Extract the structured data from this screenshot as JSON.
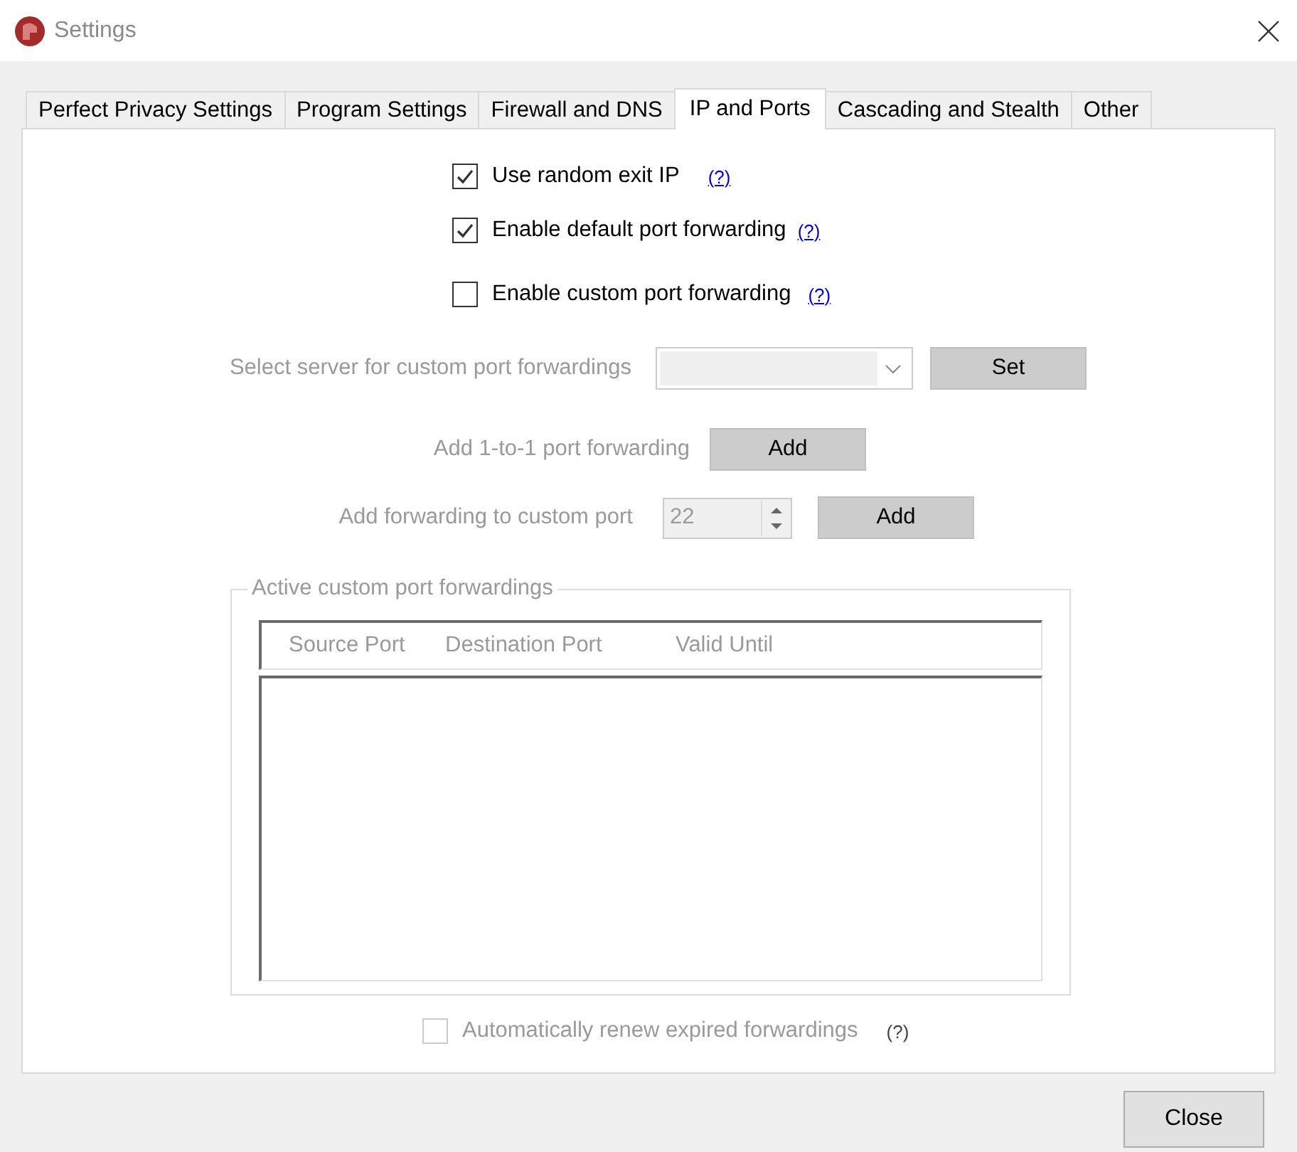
{
  "window": {
    "title": "Settings"
  },
  "tabs": [
    {
      "label": "Perfect Privacy Settings",
      "selected": false
    },
    {
      "label": "Program Settings",
      "selected": false
    },
    {
      "label": "Firewall and DNS",
      "selected": false
    },
    {
      "label": "IP and Ports",
      "selected": true
    },
    {
      "label": "Cascading and Stealth",
      "selected": false
    },
    {
      "label": "Other",
      "selected": false
    }
  ],
  "options": [
    {
      "label": "Use random exit IP",
      "checked": true,
      "disabled": false,
      "help": "(?)"
    },
    {
      "label": "Enable default port forwarding",
      "checked": true,
      "disabled": false,
      "help": "(?)"
    },
    {
      "label": "Enable custom port forwarding",
      "checked": false,
      "disabled": false,
      "help": "(?)"
    }
  ],
  "server_select": {
    "label": "Select server for custom port forwardings",
    "disabled": true,
    "button": "Set"
  },
  "one_to_one": {
    "label": "Add 1-to-1 port forwarding",
    "disabled": true,
    "button": "Add"
  },
  "custom_port": {
    "label": "Add forwarding to custom port",
    "disabled": true,
    "value": "22",
    "button": "Add"
  },
  "forwardings_group": {
    "title": "Active custom port forwardings",
    "disabled": true,
    "columns": [
      "Source Port",
      "Destination Port",
      "Valid Until"
    ]
  },
  "auto_renew": {
    "label": "Automatically renew expired forwardings",
    "checked": false,
    "disabled": true,
    "help": "(?)"
  },
  "buttons": [
    "Close"
  ]
}
